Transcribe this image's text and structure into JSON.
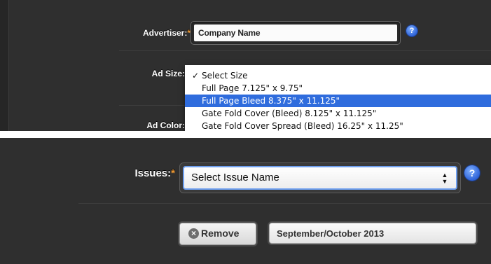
{
  "top_form": {
    "advertiser_label": "Advertiser:",
    "required_mark": "*",
    "advertiser_value": "Company Name",
    "ad_size_label": "Ad Size:",
    "ad_color_label": "Ad Color:",
    "help_glyph": "?",
    "ad_size_options": [
      {
        "label": "Select Size",
        "checked": true,
        "highlighted": false
      },
      {
        "label": "Full Page 7.125\" x 9.75\"",
        "checked": false,
        "highlighted": false
      },
      {
        "label": "Full Page Bleed 8.375\" x 11.125\"",
        "checked": false,
        "highlighted": true
      },
      {
        "label": "Gate Fold Cover (Bleed) 8.125\" x 11.125\"",
        "checked": false,
        "highlighted": false
      },
      {
        "label": "Gate Fold Cover Spread (Bleed) 16.25\" x 11.25\"",
        "checked": false,
        "highlighted": false
      }
    ],
    "check_glyph": "✓"
  },
  "bottom_form": {
    "issues_label": "Issues:",
    "required_mark": "*",
    "issues_select_value": "Select Issue Name",
    "help_glyph": "?",
    "remove_label": "Remove",
    "remove_glyph": "×",
    "selected_issue": "September/October 2013"
  },
  "colors": {
    "panel_bg": "#2f2f2f",
    "required": "#f39c34",
    "highlight": "#2f6cdd",
    "help": "#2e63d8"
  }
}
